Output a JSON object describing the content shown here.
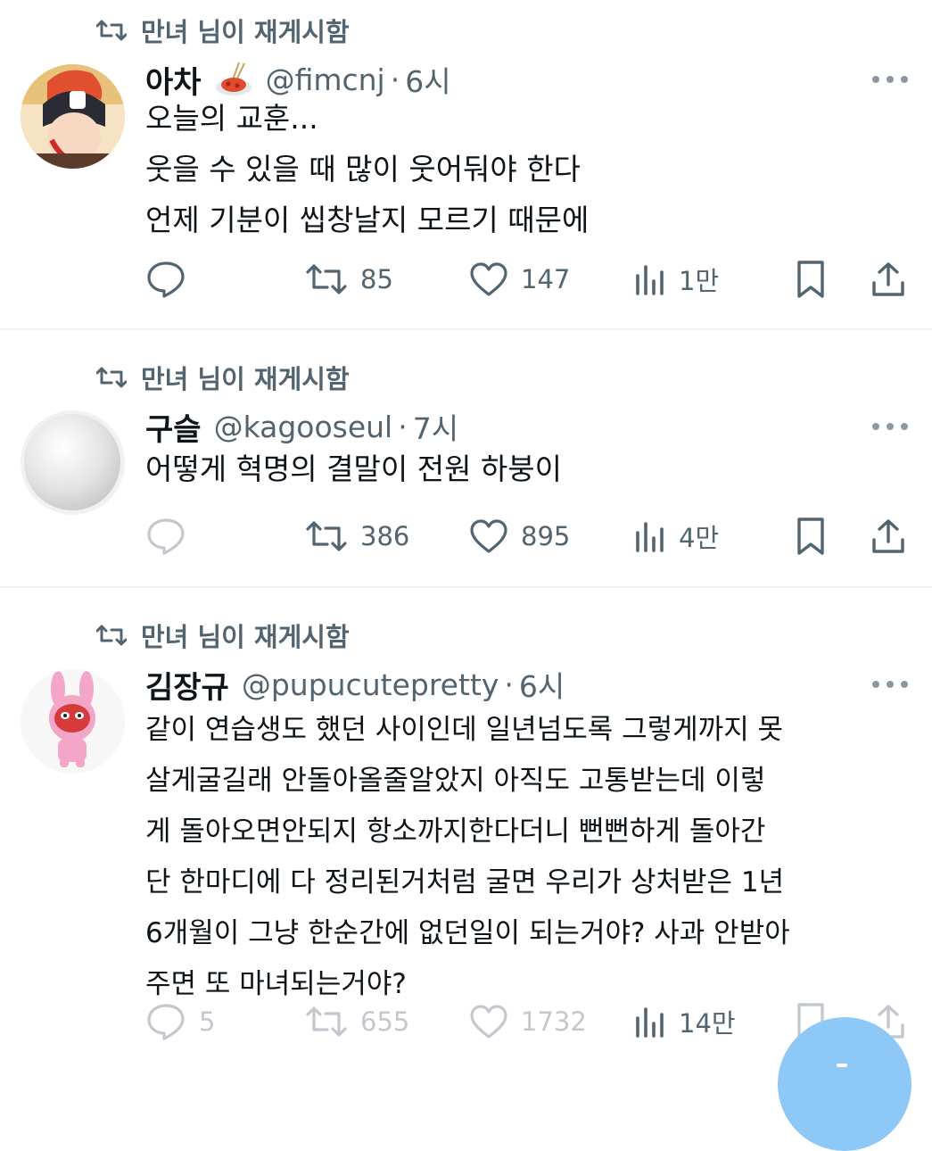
{
  "tweets": [
    {
      "retweeted_by": "만녀 님이 재게시함",
      "name": "아차",
      "emoji_icon": "spaghetti-emoji",
      "handle": "@fimcnj",
      "time": "6시",
      "text": "오늘의 교훈...\n웃을 수 있을 때 많이 웃어둬야 한다\n언제 기분이 씹창날지 모르기 때문에",
      "replies": "",
      "retweets": "85",
      "likes": "147",
      "views": "1만"
    },
    {
      "retweeted_by": "만녀 님이 재게시함",
      "name": "구슬",
      "handle": "@kagooseul",
      "time": "7시",
      "text": "어떻게 혁명의 결말이 전원 하붕이",
      "replies": "",
      "retweets": "386",
      "likes": "895",
      "views": "4만"
    },
    {
      "retweeted_by": "만녀 님이 재게시함",
      "name": "김장규",
      "handle": "@pupucutepretty",
      "time": "6시",
      "text": "같이 연습생도 했던 사이인데 일년넘도록 그렇게까지 못\n살게굴길래 안돌아올줄알았지 아직도 고통받는데 이렇\n게 돌아오면안되지 항소까지한다더니 뻔뻔하게 돌아간\n단 한마디에 다 정리된거처럼 굴면 우리가 상처받은 1년\n6개월이 그냥 한순간에 없던일이 되는거야? 사과 안받아\n주면 또 마녀되는거야?",
      "replies": "5",
      "retweets": "655",
      "likes": "1732",
      "views": "14만"
    }
  ],
  "separator_dot": "·",
  "colors": {
    "text": "#0f1419",
    "secondary": "#536471",
    "divider": "#eff3f4",
    "fab": "#8ec8f7"
  }
}
